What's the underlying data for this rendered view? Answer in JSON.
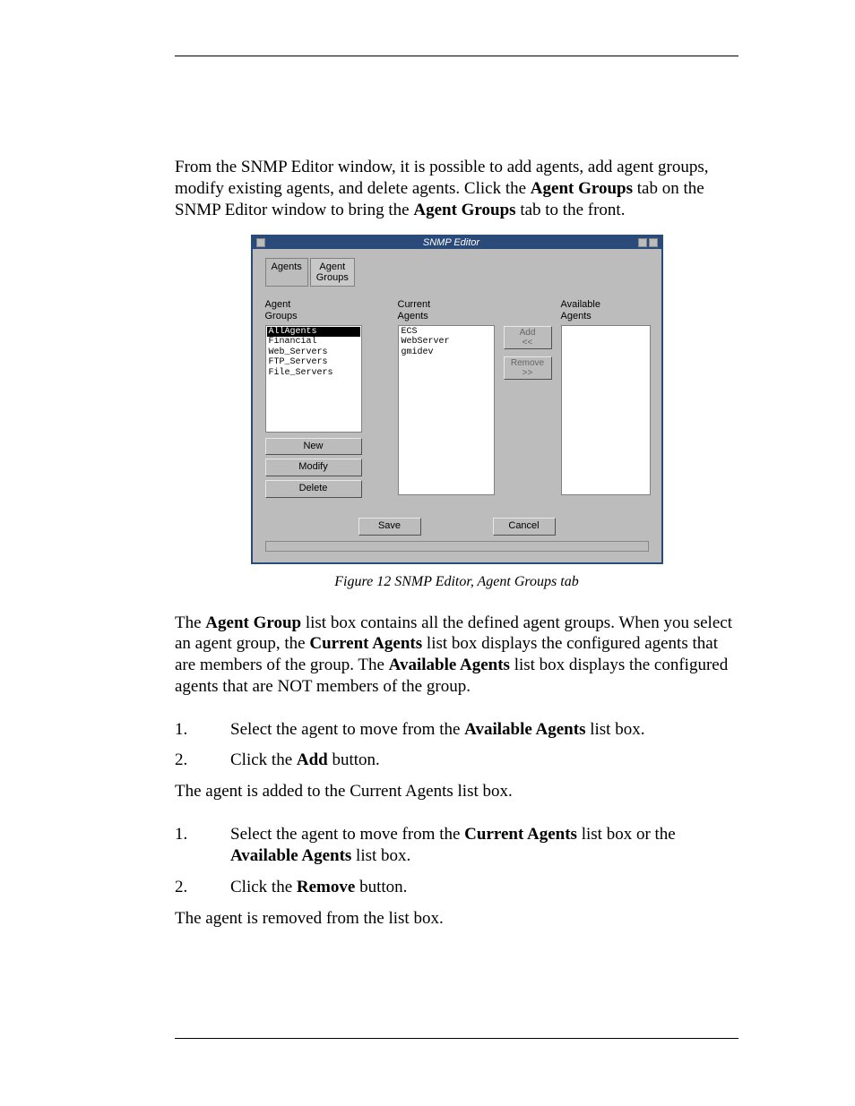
{
  "intro": {
    "p1_a": "From the SNMP Editor window, it is possible to add agents, add agent groups, modify existing agents, and delete agents. Click the ",
    "p1_b": "Agent Groups",
    "p1_c": " tab on the SNMP Editor window to bring the ",
    "p1_d": "Agent Groups",
    "p1_e": " tab to the front."
  },
  "window": {
    "title": "SNMP Editor",
    "tabs": {
      "agents": "Agents",
      "groups1": "Agent",
      "groups2": "Groups"
    },
    "labels": {
      "agent_groups1": "Agent",
      "agent_groups2": "Groups",
      "current_agents1": "Current",
      "current_agents2": "Agents",
      "available_agents1": "Available",
      "available_agents2": "Agents"
    },
    "group_list": [
      "AllAgents",
      "Financial",
      "Web_Servers",
      "FTP_Servers",
      "File_Servers"
    ],
    "current_list": [
      "ECS",
      "WebServer",
      "gmidev"
    ],
    "buttons": {
      "new": "New",
      "modify": "Modify",
      "delete": "Delete",
      "add1": "Add",
      "add2": "<<",
      "remove1": "Remove",
      "remove2": ">>",
      "save": "Save",
      "cancel": "Cancel"
    }
  },
  "caption": "Figure 12 SNMP Editor, Agent Groups tab",
  "para2": {
    "a": "The ",
    "b": "Agent Group",
    "c": " list box contains all the defined agent groups. When you select an agent group, the ",
    "d": "Current Agents",
    "e": " list box displays the configured agents that are members of the group. The ",
    "f": "Available Agents",
    "g": " list box displays the configured agents that are NOT members of the group."
  },
  "add_steps": {
    "s1a": "Select the agent to move from the ",
    "s1b": "Available Agents",
    "s1c": " list box.",
    "s2a": "Click the ",
    "s2b": "Add",
    "s2c": " button."
  },
  "add_result": "The agent is added to the Current Agents list box.",
  "rem_steps": {
    "s1a": "Select the agent to move from the ",
    "s1b": "Current Agents",
    "s1c": " list box or the ",
    "s1d": "Available Agents",
    "s1e": " list box.",
    "s2a": "Click the ",
    "s2b": "Remove",
    "s2c": " button."
  },
  "rem_result": "The agent is removed from the list box."
}
